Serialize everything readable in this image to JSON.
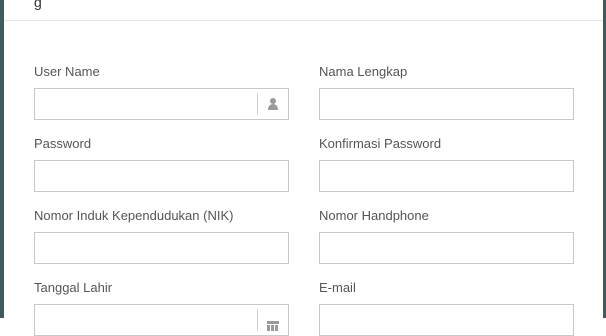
{
  "form": {
    "fields": [
      {
        "label": "User Name",
        "value": "",
        "icon": "user-icon"
      },
      {
        "label": "Nama Lengkap",
        "value": ""
      },
      {
        "label": "Password",
        "value": ""
      },
      {
        "label": "Konfirmasi Password",
        "value": ""
      },
      {
        "label": "Nomor Induk Kependudukan (NIK)",
        "value": ""
      },
      {
        "label": "Nomor Handphone",
        "value": ""
      },
      {
        "label": "Tanggal Lahir",
        "value": "",
        "icon": "calendar-icon"
      },
      {
        "label": "E-mail",
        "value": ""
      }
    ]
  }
}
